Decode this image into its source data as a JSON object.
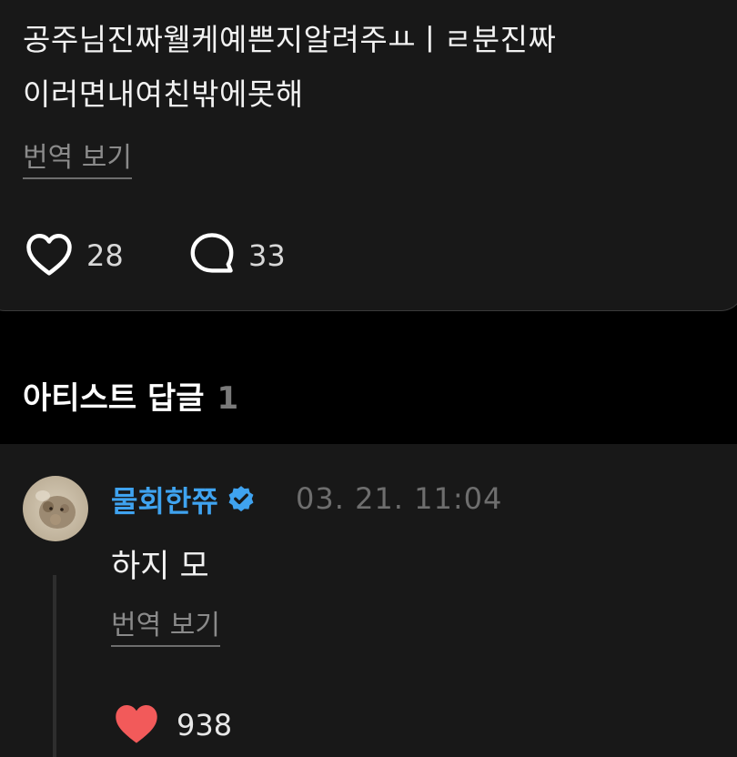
{
  "post": {
    "text_line1": "공주님진짜웰케예쁜지알려주ㅛㅣㄹ분진짜",
    "text_line2": "이러면내여친밖에못해",
    "translate_label": "번역 보기",
    "likes": "28",
    "comments": "33"
  },
  "artist_replies": {
    "title": "아티스트 답글",
    "count": "1"
  },
  "reply": {
    "author": "물회한쮸",
    "date": "03. 21. 11:04",
    "text": "하지 모",
    "translate_label": "번역 보기",
    "likes": "938"
  },
  "colors": {
    "accent": "#3fa3f0",
    "heart_liked": "#f25a5a",
    "background": "#000000",
    "card": "#181818"
  },
  "icons": {
    "like": "heart-outline-icon",
    "comment": "speech-bubble-icon",
    "verified": "verified-badge-icon",
    "liked": "heart-filled-icon"
  }
}
